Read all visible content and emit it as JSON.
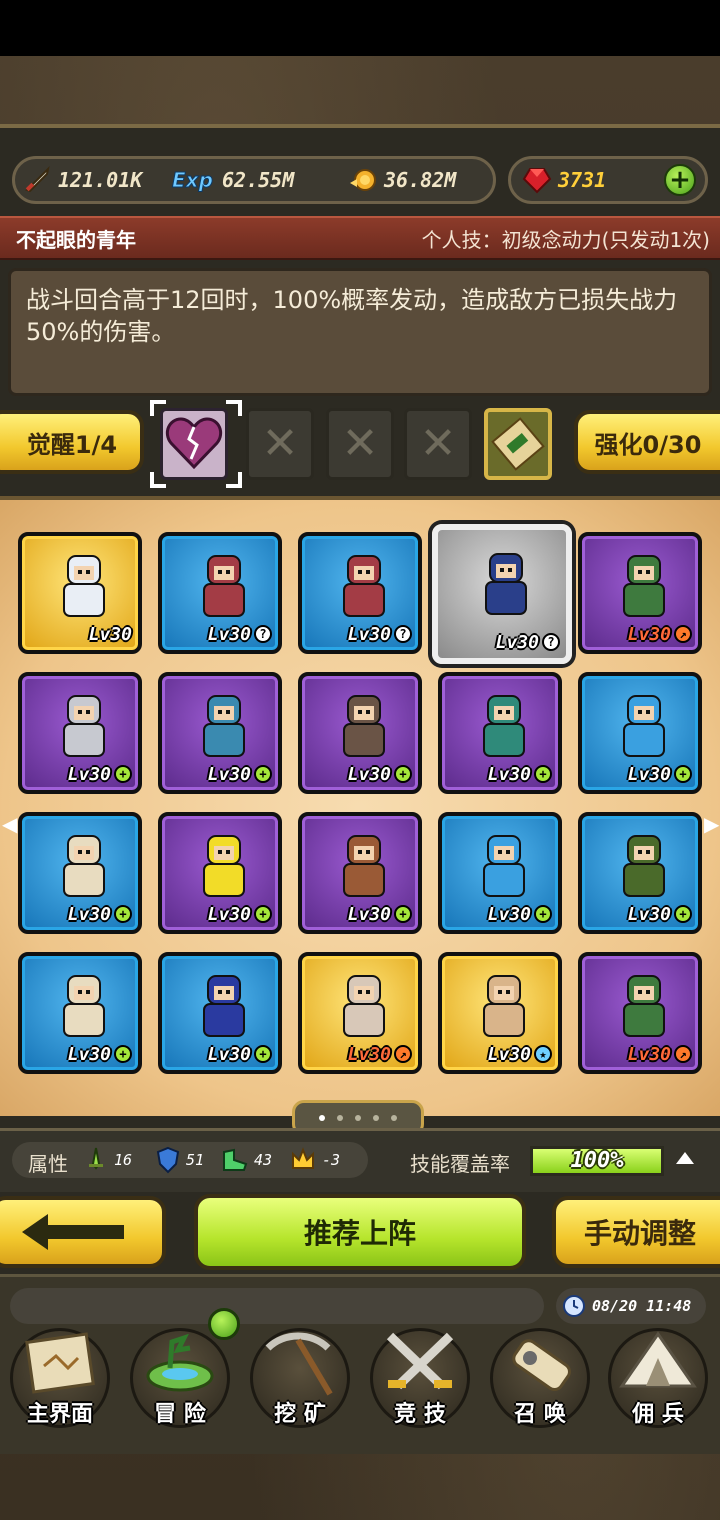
{
  "resources": {
    "power": "121.01K",
    "exp_label": "Exp",
    "exp": "62.55M",
    "coins": "36.82M",
    "gems": "3731"
  },
  "hero": {
    "name": "不起眼的青年",
    "skill": "个人技：初级念动力(只发动1次)",
    "description": "战斗回合高于12回时，100%概率发动，造成敌方已损失战力50%的伤害。"
  },
  "awaken": {
    "label": "觉醒1/4"
  },
  "enhance": {
    "label": "强化0/30"
  },
  "cards": [
    {
      "lvl": "Lv30",
      "rarity": "gold",
      "badge": "none",
      "name": "white-bear"
    },
    {
      "lvl": "Lv30",
      "rarity": "blue",
      "badge": "q",
      "name": "red-creature"
    },
    {
      "lvl": "Lv30",
      "rarity": "blue",
      "badge": "q",
      "name": "red-creature"
    },
    {
      "lvl": "Lv30",
      "rarity": "gray",
      "badge": "q",
      "name": "young-man"
    },
    {
      "lvl": "Lv30",
      "rarity": "purple",
      "badge": "o",
      "name": "green-warrior"
    },
    {
      "lvl": "Lv30",
      "rarity": "purple",
      "badge": "g",
      "name": "silver-knight"
    },
    {
      "lvl": "Lv30",
      "rarity": "purple",
      "badge": "g",
      "name": "blue-dragon"
    },
    {
      "lvl": "Lv30",
      "rarity": "purple",
      "badge": "g",
      "name": "horse-rider"
    },
    {
      "lvl": "Lv30",
      "rarity": "purple",
      "badge": "g",
      "name": "green-hair-man"
    },
    {
      "lvl": "Lv30",
      "rarity": "blue",
      "badge": "g",
      "name": "blue-hair-girl"
    },
    {
      "lvl": "Lv30",
      "rarity": "blue",
      "badge": "g",
      "name": "blonde-woman"
    },
    {
      "lvl": "Lv30",
      "rarity": "purple",
      "badge": "g",
      "name": "yellow-robot"
    },
    {
      "lvl": "Lv30",
      "rarity": "purple",
      "badge": "g",
      "name": "goggles-boy"
    },
    {
      "lvl": "Lv30",
      "rarity": "blue",
      "badge": "g",
      "name": "blue-hair-girl"
    },
    {
      "lvl": "Lv30",
      "rarity": "blue",
      "badge": "g",
      "name": "hooded-figure"
    },
    {
      "lvl": "Lv30",
      "rarity": "blue",
      "badge": "g",
      "name": "blonde-woman"
    },
    {
      "lvl": "Lv30",
      "rarity": "blue",
      "badge": "g",
      "name": "navy-girl"
    },
    {
      "lvl": "Lv30",
      "rarity": "gold",
      "badge": "o",
      "name": "old-sage"
    },
    {
      "lvl": "Lv30",
      "rarity": "gold",
      "badge": "s",
      "name": "bald-master"
    },
    {
      "lvl": "Lv30",
      "rarity": "purple",
      "badge": "o",
      "name": "green-warrior"
    }
  ],
  "attributes": {
    "label": "属性",
    "items": [
      {
        "icon": "sword-icon",
        "value": "16"
      },
      {
        "icon": "shield-icon",
        "value": "51"
      },
      {
        "icon": "boot-icon",
        "value": "43"
      },
      {
        "icon": "crown-icon",
        "value": "-3"
      }
    ],
    "coverage_label": "技能覆盖率",
    "coverage_text": "100%",
    "coverage_value": 1.0
  },
  "actions": {
    "recommend": "推荐上阵",
    "manual": "手动调整"
  },
  "time": "08/20 11:48",
  "nav": [
    {
      "label": "主界面",
      "icon": "map-icon"
    },
    {
      "label": "冒 险",
      "icon": "island-icon"
    },
    {
      "label": "挖 矿",
      "icon": "pickaxe-icon"
    },
    {
      "label": "竞 技",
      "icon": "swords-icon"
    },
    {
      "label": "召 唤",
      "icon": "scroll-icon"
    },
    {
      "label": "佣 兵",
      "icon": "tent-icon"
    }
  ],
  "colors": {
    "title_strip": "#8c3b2a",
    "accent_green": "#a5e83a",
    "accent_gold": "#f2c82d"
  }
}
